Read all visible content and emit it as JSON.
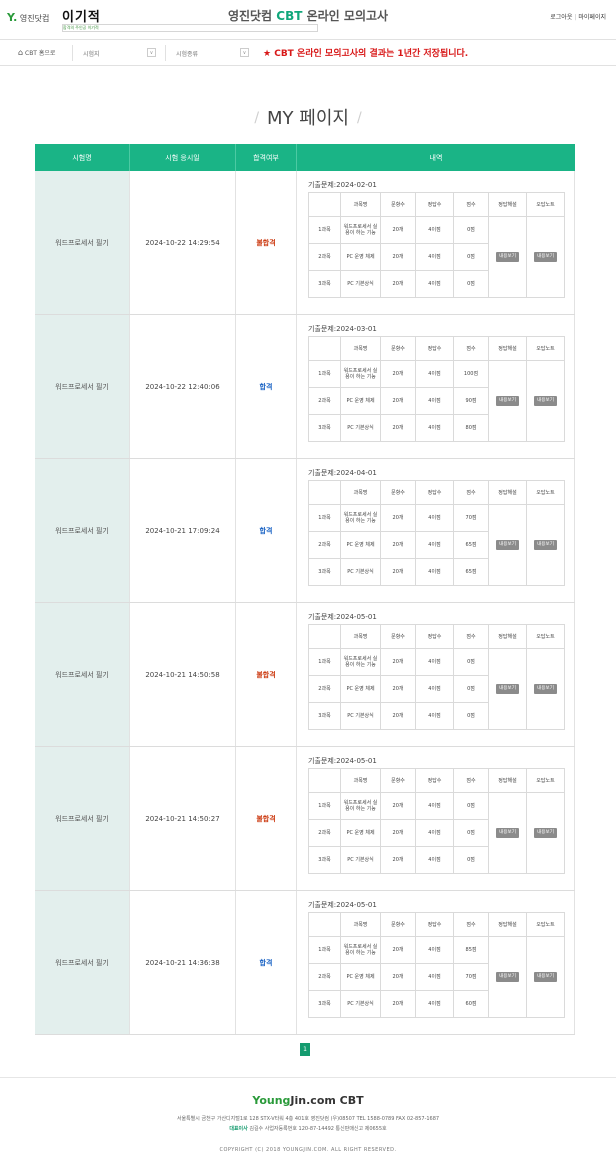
{
  "header": {
    "logo1_mark": "Y.",
    "logo1_text": "영진닷컴",
    "logo2_text": "이기적",
    "logo2_sub": "합격의 주인공 이기적",
    "title_part1": "영진닷컴 ",
    "title_cbt": "CBT",
    "title_part2": " 온라인 모의고사",
    "login": "로그아웃",
    "mypage": "마이페이지"
  },
  "nav": {
    "home": "CBT 홈으로",
    "select1": "시험지",
    "select2": "시험종류",
    "notice": "CBT 온라인 모의고사의 결과는 1년간 저장됩니다."
  },
  "page": {
    "title": "MY 페이지"
  },
  "table": {
    "headers": [
      "시험명",
      "시험 응시일",
      "합격여부",
      "내역"
    ],
    "sub_headers": [
      "과목명",
      "문항수",
      "정답수",
      "점수",
      "정답해설",
      "오답노트"
    ],
    "button_solution": "내용보기",
    "button_wrong": "내용보기",
    "rows": [
      {
        "name": "워드프로세서 필기",
        "date": "2024-10-22 14:29:54",
        "result": "불합격",
        "status": "fail",
        "exam": "기출문제:2024-02-01",
        "subjects": [
          {
            "no": "1과목",
            "title": "워드프로세서 실용이 하는 기능",
            "q": "20개",
            "c": "4이점",
            "s": "0점"
          },
          {
            "no": "2과목",
            "title": "PC 운영 체제",
            "q": "20개",
            "c": "4이점",
            "s": "0점"
          },
          {
            "no": "3과목",
            "title": "PC 기본상식",
            "q": "20개",
            "c": "4이점",
            "s": "0점"
          }
        ]
      },
      {
        "name": "워드프로세서 필기",
        "date": "2024-10-22 12:40:06",
        "result": "합격",
        "status": "pass",
        "exam": "기출문제:2024-03-01",
        "subjects": [
          {
            "no": "1과목",
            "title": "워드프로세서 실용이 하는 기능",
            "q": "20개",
            "c": "4이점",
            "s": "100점"
          },
          {
            "no": "2과목",
            "title": "PC 운영 체제",
            "q": "20개",
            "c": "4이점",
            "s": "90점"
          },
          {
            "no": "3과목",
            "title": "PC 기본상식",
            "q": "20개",
            "c": "4이점",
            "s": "80점"
          }
        ]
      },
      {
        "name": "워드프로세서 필기",
        "date": "2024-10-21 17:09:24",
        "result": "합격",
        "status": "pass",
        "exam": "기출문제:2024-04-01",
        "subjects": [
          {
            "no": "1과목",
            "title": "워드프로세서 실용이 하는 기능",
            "q": "20개",
            "c": "4이점",
            "s": "70점"
          },
          {
            "no": "2과목",
            "title": "PC 운영 체제",
            "q": "20개",
            "c": "4이점",
            "s": "65점"
          },
          {
            "no": "3과목",
            "title": "PC 기본상식",
            "q": "20개",
            "c": "4이점",
            "s": "65점"
          }
        ]
      },
      {
        "name": "워드프로세서 필기",
        "date": "2024-10-21 14:50:58",
        "result": "불합격",
        "status": "fail",
        "exam": "기출문제:2024-05-01",
        "subjects": [
          {
            "no": "1과목",
            "title": "워드프로세서 실용이 하는 기능",
            "q": "20개",
            "c": "4이점",
            "s": "0점"
          },
          {
            "no": "2과목",
            "title": "PC 운영 체제",
            "q": "20개",
            "c": "4이점",
            "s": "0점"
          },
          {
            "no": "3과목",
            "title": "PC 기본상식",
            "q": "20개",
            "c": "4이점",
            "s": "0점"
          }
        ]
      },
      {
        "name": "워드프로세서 필기",
        "date": "2024-10-21 14:50:27",
        "result": "불합격",
        "status": "fail",
        "exam": "기출문제:2024-05-01",
        "subjects": [
          {
            "no": "1과목",
            "title": "워드프로세서 실용이 하는 기능",
            "q": "20개",
            "c": "4이점",
            "s": "0점"
          },
          {
            "no": "2과목",
            "title": "PC 운영 체제",
            "q": "20개",
            "c": "4이점",
            "s": "0점"
          },
          {
            "no": "3과목",
            "title": "PC 기본상식",
            "q": "20개",
            "c": "4이점",
            "s": "0점"
          }
        ]
      },
      {
        "name": "워드프로세서 필기",
        "date": "2024-10-21 14:36:38",
        "result": "합격",
        "status": "pass",
        "exam": "기출문제:2024-05-01",
        "subjects": [
          {
            "no": "1과목",
            "title": "워드프로세서 실용이 하는 기능",
            "q": "20개",
            "c": "4이점",
            "s": "85점"
          },
          {
            "no": "2과목",
            "title": "PC 운영 체제",
            "q": "20개",
            "c": "4이점",
            "s": "70점"
          },
          {
            "no": "3과목",
            "title": "PC 기본상식",
            "q": "20개",
            "c": "4이점",
            "s": "60점"
          }
        ]
      }
    ]
  },
  "pagination": {
    "current": "1"
  },
  "footer": {
    "logo_part1": "Young",
    "logo_part2": "Jin.com CBT",
    "address": "서울특별시 금천구 가산디지털1로 128 STX-V타워 4층 401호 영진닷컴 (우)08507 TEL 1588-0789 FAX 02-857-1687",
    "biz_prefix": "대표이사",
    "biz_text": " 김길수 사업자등록번호 120-87-14492 통신판매신고 제0655호",
    "copyright": "COPYRIGHT (C) 2018 YOUNGJIN.COM. ALL RIGHT RESERVED."
  },
  "colors": {
    "accent": "#1ab486",
    "fail": "#cc3b12",
    "pass": "#1a63c4",
    "notice": "#d81818"
  }
}
